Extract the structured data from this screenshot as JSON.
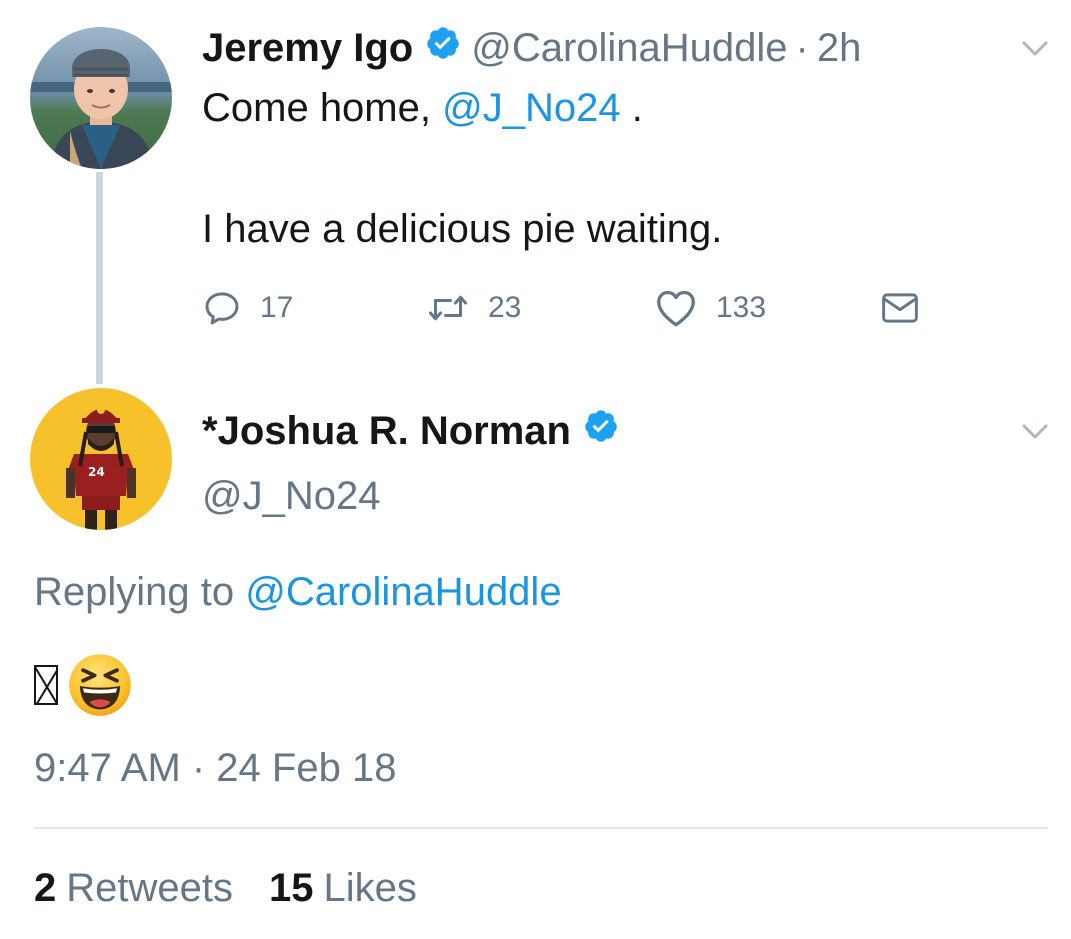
{
  "parent_tweet": {
    "display_name": "Jeremy Igo",
    "handle": "@CarolinaHuddle",
    "separator": "·",
    "time": "2h",
    "text_line1_prefix": "Come home, ",
    "text_line1_mention": "@J_No24",
    "text_line1_suffix": " .",
    "text_line2": "I have a delicious pie waiting.",
    "replies_count": "17",
    "retweets_count": "23",
    "likes_count": "133"
  },
  "reply_tweet": {
    "display_name": "*Joshua R. Norman",
    "handle": "@J_No24",
    "replying_to_prefix": "Replying to ",
    "replying_to_handle": "@CarolinaHuddle",
    "timestamp": "9:47 AM · 24 Feb 18",
    "retweets_count": "2",
    "retweets_label": "Retweets",
    "likes_count": "15",
    "likes_label": "Likes"
  },
  "colors": {
    "link": "#1b95e0",
    "secondary": "#657786",
    "primary_text": "#14171a",
    "verified": "#1da1f2",
    "divider": "#e1e8ed",
    "thread_line": "#ccd6dd"
  },
  "icons": {
    "verified": "verified-badge-icon",
    "chevron": "chevron-down-icon",
    "reply": "reply-icon",
    "retweet": "retweet-icon",
    "like": "heart-icon",
    "dm": "envelope-icon",
    "emoji": "laughing-squint-emoji"
  }
}
